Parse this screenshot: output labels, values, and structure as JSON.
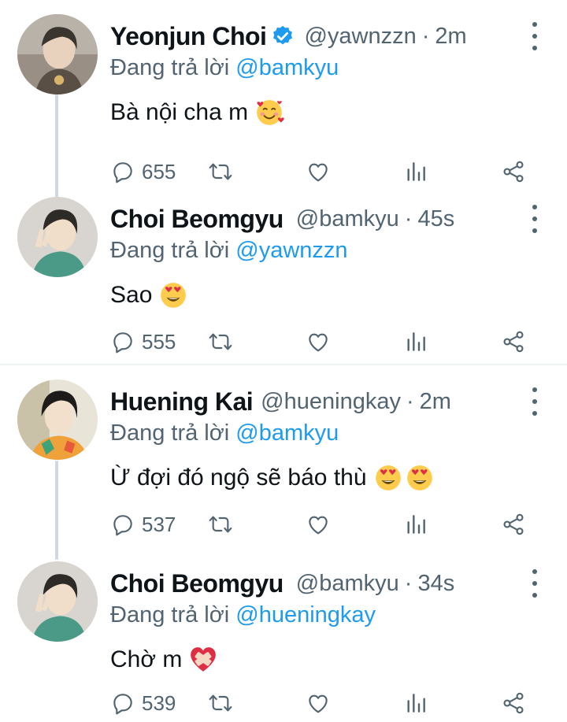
{
  "reply_prefix": "Đang trả lời",
  "tweets": [
    {
      "name": "Yeonjun Choi",
      "verified": true,
      "handle": "@yawnzzn",
      "separator": "·",
      "time": "2m",
      "reply_to": "@bamkyu",
      "text": "Bà nội cha m",
      "emojis": [
        "smiling-face-with-hearts"
      ],
      "replies": "655"
    },
    {
      "name": "Choi Beomgyu",
      "verified": false,
      "handle": "@bamkyu",
      "separator": "·",
      "time": "45s",
      "reply_to": "@yawnzzn",
      "text": "Sao",
      "emojis": [
        "heart-eyes"
      ],
      "replies": "555"
    },
    {
      "name": "Huening Kai",
      "verified": false,
      "handle": "@hueningkay",
      "separator": "·",
      "time": "2m",
      "reply_to": "@bamkyu",
      "text": "Ừ đợi đó ngộ sẽ báo thù",
      "emojis": [
        "heart-eyes",
        "heart-eyes"
      ],
      "replies": "537"
    },
    {
      "name": "Choi Beomgyu",
      "verified": false,
      "handle": "@bamkyu",
      "separator": "·",
      "time": "34s",
      "reply_to": "@hueningkay",
      "text": "Chờ m",
      "emojis": [
        "mending-heart"
      ],
      "replies": "539"
    }
  ],
  "icons": {
    "reply": "speech-bubble-icon",
    "retweet": "retweet-icon",
    "like": "heart-icon",
    "views": "analytics-icon",
    "share": "share-icon",
    "more": "more-vertical-icon"
  },
  "colors": {
    "accent": "#1d9bf0",
    "muted": "#536471",
    "text": "#0f1419",
    "thread_line": "#cfd9de"
  }
}
